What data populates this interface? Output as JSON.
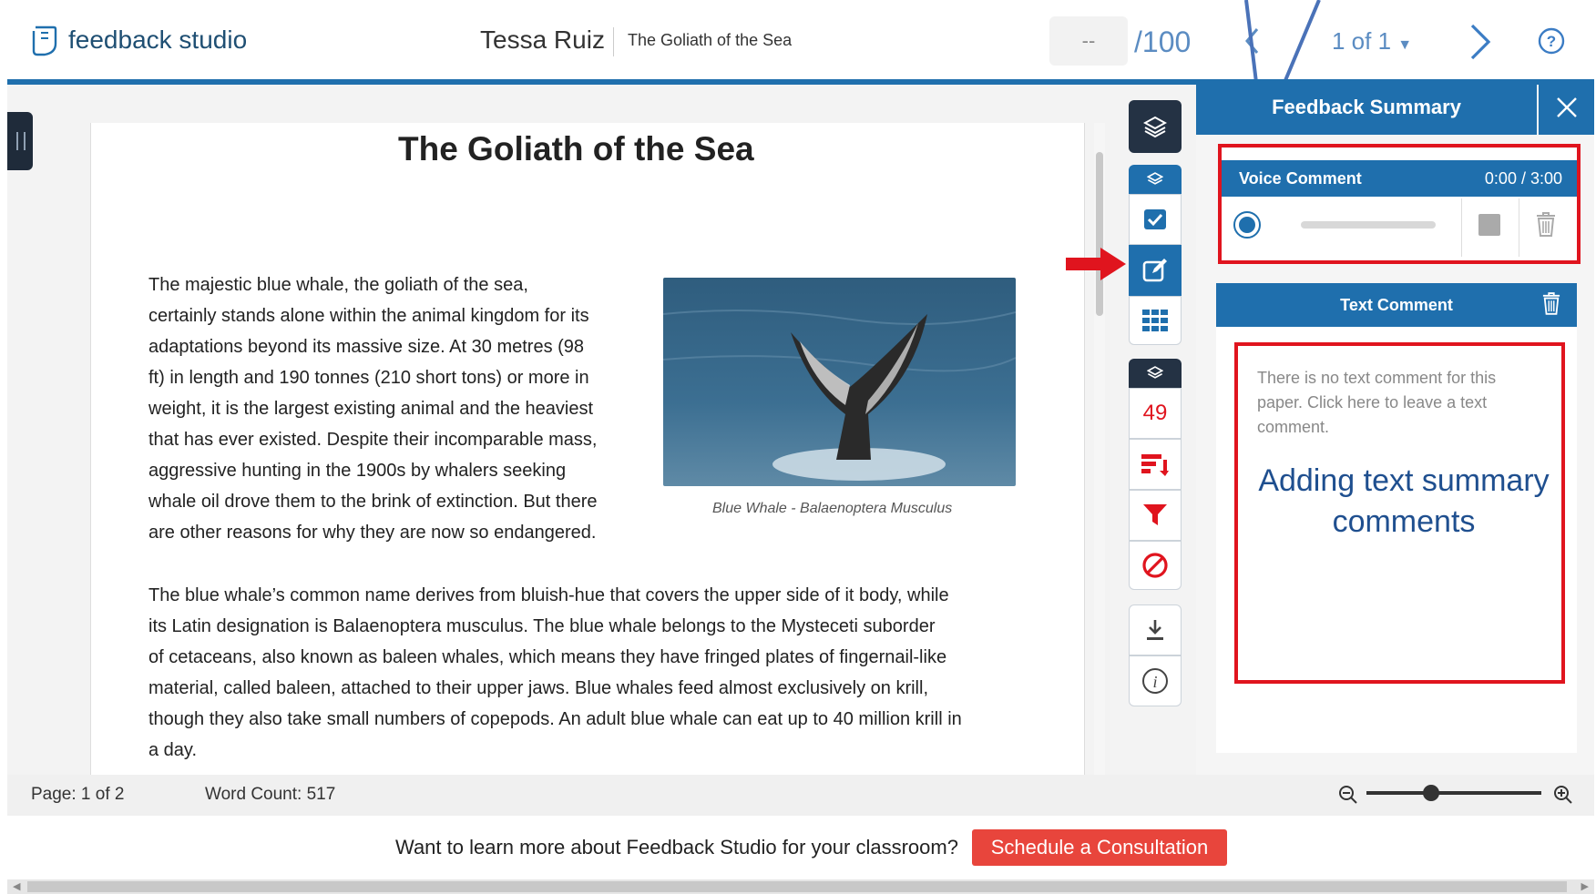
{
  "header": {
    "logo_text": "feedback studio",
    "student_name": "Tessa Ruiz",
    "paper_title": "The Goliath of the Sea",
    "grade_value": "--",
    "grade_max": "/100",
    "pager_label": "1 of 1"
  },
  "document": {
    "title": "The Goliath of the Sea",
    "para1_lines": [
      "The majestic blue whale, the goliath of the sea,",
      "certainly stands alone within the animal kingdom for its",
      "adaptations beyond its massive size. At 30 metres (98",
      "ft) in length and 190 tonnes (210 short tons) or more in",
      "weight, it is the largest existing animal and the heaviest",
      "that has ever existed. Despite their incomparable mass,",
      "aggressive hunting in the 1900s by whalers seeking",
      "whale oil drove them to the brink of extinction. But there",
      "are other reasons for why they are now so endangered."
    ],
    "para2_lines": [
      "The blue whale’s common name derives from bluish-hue that covers the upper side of it body, while",
      "its Latin designation is Balaenoptera musculus. The blue whale belongs to the Mysteceti suborder",
      "of cetaceans, also known as baleen whales, which means they have fringed plates of fingernail-like",
      "material, called baleen, attached to their upper jaws. Blue whales feed almost exclusively on krill,",
      "though they also take small numbers of copepods. An adult blue whale can eat up to 40 million krill in",
      "a day."
    ],
    "image_caption": "Blue Whale - Balaenoptera Musculus"
  },
  "tools": {
    "similarity_score": "49"
  },
  "feedback_summary": {
    "title": "Feedback Summary",
    "voice_comment_label": "Voice Comment",
    "voice_time": "0:00 / 3:00",
    "text_comment_label": "Text Comment",
    "text_placeholder": "There is no text comment for this paper. Click here to leave a text comment.",
    "annotation": "Adding text summary comments"
  },
  "status": {
    "page": "Page: 1 of 2",
    "word_count": "Word Count: 517",
    "zoom_level": 0.37
  },
  "promo": {
    "text": "Want to learn more about Feedback Studio for your classroom?",
    "button": "Schedule a Consultation"
  },
  "colors": {
    "primary_blue": "#1f6fad",
    "dark_tool": "#243244",
    "alert_red": "#e0141e",
    "promo_red": "#e8453c",
    "annotation_blue": "#1f4f8f"
  }
}
